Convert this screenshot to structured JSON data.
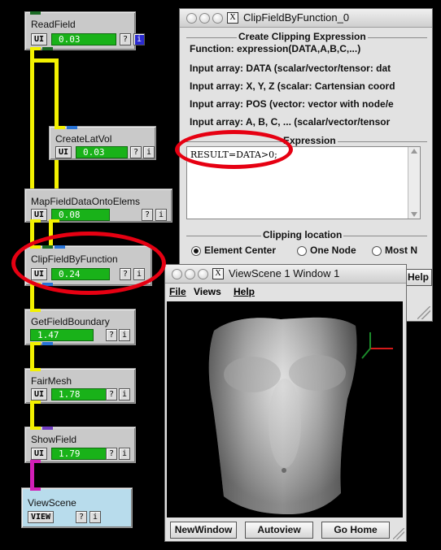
{
  "network": {
    "modules": {
      "read_field": {
        "title": "ReadField",
        "ui": "UI",
        "value": "0.03",
        "help": "?",
        "info": "i"
      },
      "create_lat_vol": {
        "title": "CreateLatVol",
        "ui": "UI",
        "value": "0.03",
        "help": "?",
        "info": "i"
      },
      "map_field": {
        "title": "MapFieldDataOntoElems",
        "ui": "UI",
        "value": "0.08",
        "help": "?",
        "info": "i"
      },
      "clip_field": {
        "title": "ClipFieldByFunction",
        "ui": "UI",
        "value": "0.24",
        "help": "?",
        "info": "i"
      },
      "get_boundary": {
        "title": "GetFieldBoundary",
        "value": "1.47",
        "help": "?",
        "info": "i"
      },
      "fair_mesh": {
        "title": "FairMesh",
        "ui": "UI",
        "value": "1.78",
        "help": "?",
        "info": "i"
      },
      "show_field": {
        "title": "ShowField",
        "ui": "UI",
        "value": "1.79",
        "help": "?",
        "info": "i"
      },
      "view_scene": {
        "title": "ViewScene",
        "ui": "VIEW",
        "help": "?",
        "info": "i"
      }
    }
  },
  "clip_window": {
    "title": "ClipFieldByFunction_0",
    "create_group_label": "Create Clipping Expression",
    "lines": [
      "Function: expression(DATA,A,B,C,...)",
      "Input array: DATA (scalar/vector/tensor: dat",
      "Input array: X, Y, Z (scalar: Cartensian coord",
      "Input array: POS (vector: vector with node/e",
      "Input array: A, B, C, ... (scalar/vector/tensor"
    ],
    "expression_label": "Expression",
    "expression_value": "RESULT=DATA>0;",
    "clipping_label": "Clipping location",
    "options": [
      "Element Center",
      "One Node",
      "Most N"
    ],
    "selected_option": "Element Center",
    "help_label": "Help"
  },
  "viewscene_window": {
    "title": "ViewScene 1 Window 1",
    "menu": [
      "File",
      "Views",
      "Help"
    ],
    "buttons": [
      "NewWindow",
      "Autoview",
      "Go Home"
    ]
  },
  "colors": {
    "wire_yellow": "#f3f100",
    "wire_magenta": "#d21fb7",
    "progress_green": "#19b219",
    "highlight_red": "#e60012",
    "viewscene_module": "#b8dcec"
  }
}
